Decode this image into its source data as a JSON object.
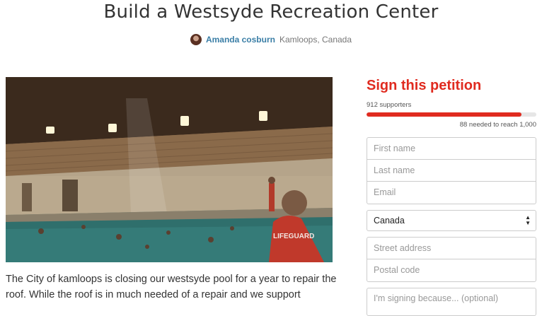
{
  "header": {
    "title": "Build a Westsyde Recreation Center",
    "author_name": "Amanda cosburn",
    "author_location": "Kamloops, Canada"
  },
  "media": {
    "image_icon": "pool-photo"
  },
  "description": {
    "text": "The City of kamloops is closing our westsyde pool for a year to repair the roof. While the roof is in much needed of a repair and we support"
  },
  "petition": {
    "heading": "Sign this petition",
    "supporters_text": "912 supporters",
    "supporters_count": 912,
    "goal": 1000,
    "progress_fraction": 0.912,
    "needed_text": "88 needed to reach 1,000",
    "accent_color": "#e02b20"
  },
  "form": {
    "first_name_placeholder": "First name",
    "last_name_placeholder": "Last name",
    "email_placeholder": "Email",
    "country_value": "Canada",
    "street_placeholder": "Street address",
    "postal_placeholder": "Postal code",
    "reason_placeholder": "I'm signing because... (optional)"
  }
}
